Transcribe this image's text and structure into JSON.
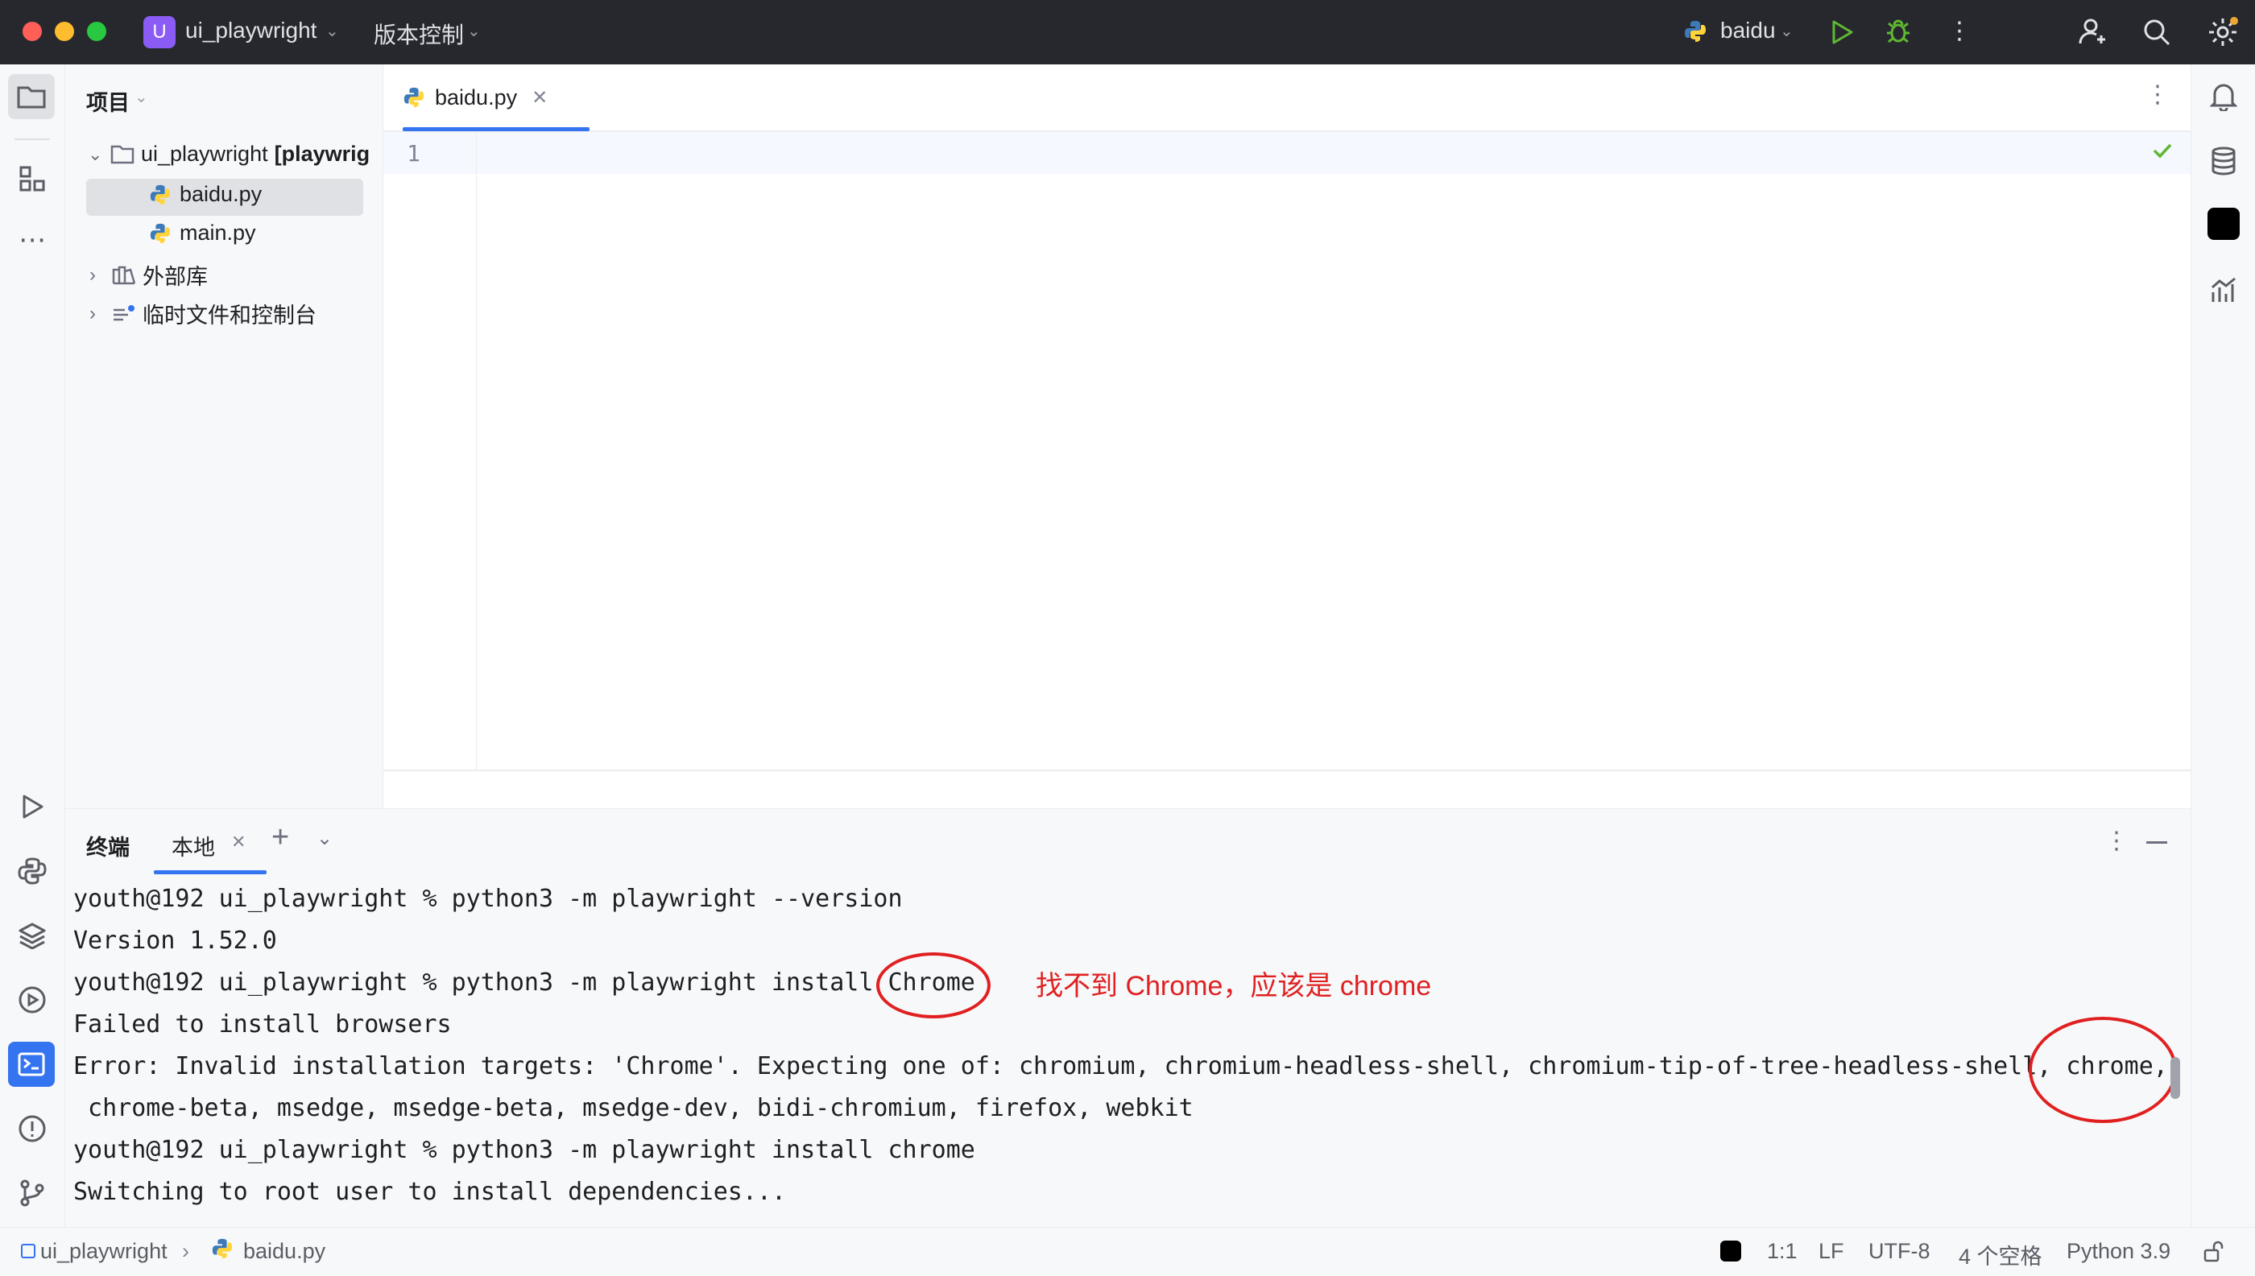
{
  "window": {
    "project_badge": "U",
    "project_name": "ui_playwright",
    "vcs_menu": "版本控制",
    "run_config": "baidu"
  },
  "project_panel": {
    "title": "项目",
    "tree": [
      {
        "label": "ui_playwright",
        "suffix": "[playwrig",
        "type": "folder",
        "expanded": true
      },
      {
        "label": "baidu.py",
        "type": "python-file",
        "selected": true
      },
      {
        "label": "main.py",
        "type": "python-file"
      },
      {
        "label": "外部库",
        "type": "library",
        "expanded": false
      },
      {
        "label": "临时文件和控制台",
        "type": "scratches",
        "expanded": false
      }
    ]
  },
  "editor": {
    "tab_label": "baidu.py",
    "line_numbers": [
      "1"
    ]
  },
  "terminal": {
    "title": "终端",
    "tab_label": "本地",
    "lines": [
      "youth@192 ui_playwright % python3 -m playwright --version",
      "Version 1.52.0",
      "youth@192 ui_playwright % python3 -m playwright install Chrome",
      "Failed to install browsers",
      "Error: Invalid installation targets: 'Chrome'. Expecting one of: chromium, chromium-headless-shell, chromium-tip-of-tree-headless-shell, chrome,",
      " chrome-beta, msedge, msedge-beta, msedge-dev, bidi-chromium, firefox, webkit",
      "youth@192 ui_playwright % python3 -m playwright install chrome",
      "Switching to root user to install dependencies..."
    ],
    "annotation": "找不到 Chrome，应该是 chrome",
    "annotation_color": "#e02020"
  },
  "statusbar": {
    "breadcrumb_project": "ui_playwright",
    "breadcrumb_file": "baidu.py",
    "position": "1:1",
    "line_separator": "LF",
    "encoding": "UTF-8",
    "indent": "4 个空格",
    "interpreter": "Python 3.9"
  },
  "colors": {
    "titlebar": "#27282e",
    "accent": "#3574f0",
    "run_green": "#5fb832",
    "badge_purple": "#8a5cf5"
  }
}
